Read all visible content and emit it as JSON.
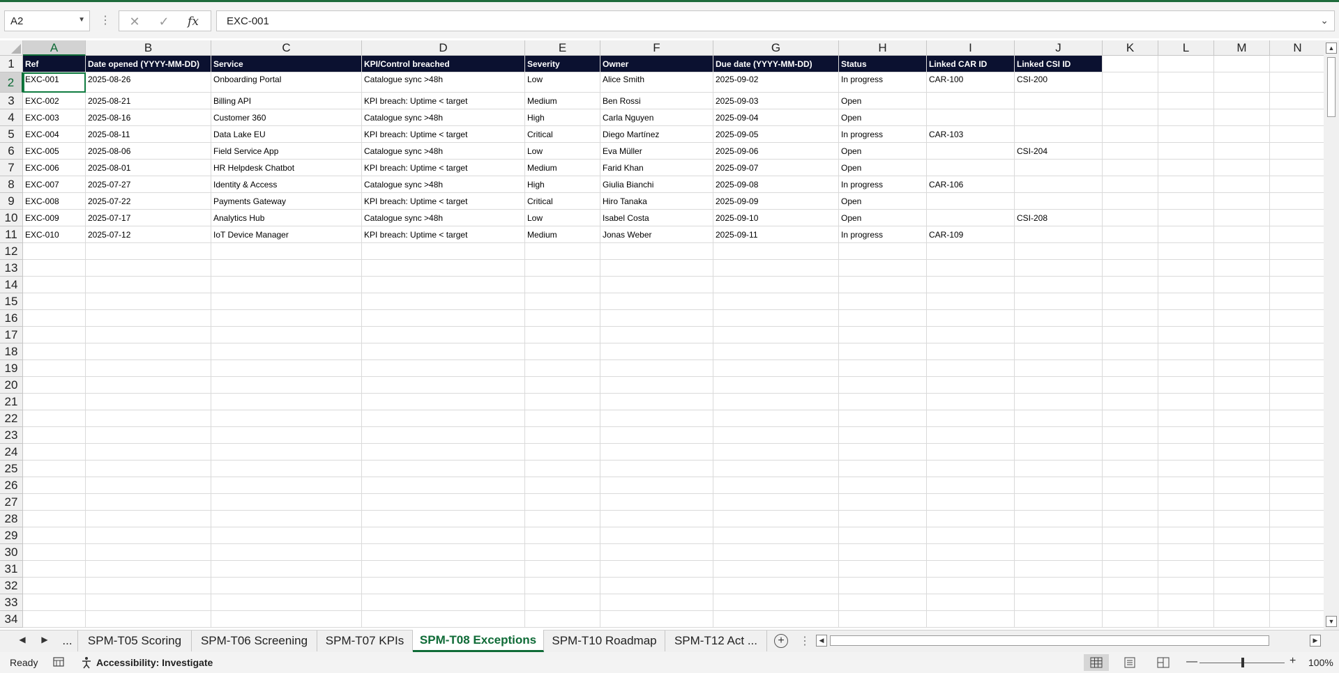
{
  "namebox": {
    "value": "A2"
  },
  "formula": {
    "value": "EXC-001"
  },
  "columns": [
    "A",
    "B",
    "C",
    "D",
    "E",
    "F",
    "G",
    "H",
    "I",
    "J",
    "K",
    "L",
    "M",
    "N"
  ],
  "rows": [
    "1",
    "2",
    "3",
    "4",
    "5",
    "6",
    "7",
    "8",
    "9",
    "10",
    "11",
    "12",
    "13",
    "14",
    "15",
    "16",
    "17",
    "18",
    "19",
    "20",
    "21",
    "22",
    "23",
    "24",
    "25",
    "26",
    "27",
    "28",
    "29",
    "30",
    "31",
    "32",
    "33",
    "34"
  ],
  "table": {
    "headers": [
      "Ref",
      "Date opened (YYYY-MM-DD)",
      "Service",
      "KPI/Control breached",
      "Severity",
      "Owner",
      "Due date (YYYY-MM-DD)",
      "Status",
      "Linked CAR ID",
      "Linked CSI ID"
    ],
    "rows": [
      [
        "EXC-001",
        "2025-08-26",
        "Onboarding Portal",
        "Catalogue sync >48h",
        "Low",
        "Alice Smith",
        "2025-09-02",
        "In progress",
        "CAR-100",
        "CSI-200"
      ],
      [
        "EXC-002",
        "2025-08-21",
        "Billing API",
        "KPI breach: Uptime < target",
        "Medium",
        "Ben Rossi",
        "2025-09-03",
        "Open",
        "",
        ""
      ],
      [
        "EXC-003",
        "2025-08-16",
        "Customer 360",
        "Catalogue sync >48h",
        "High",
        "Carla Nguyen",
        "2025-09-04",
        "Open",
        "",
        ""
      ],
      [
        "EXC-004",
        "2025-08-11",
        "Data Lake EU",
        "KPI breach: Uptime < target",
        "Critical",
        "Diego Martínez",
        "2025-09-05",
        "In progress",
        "CAR-103",
        ""
      ],
      [
        "EXC-005",
        "2025-08-06",
        "Field Service App",
        "Catalogue sync >48h",
        "Low",
        "Eva Müller",
        "2025-09-06",
        "Open",
        "",
        "CSI-204"
      ],
      [
        "EXC-006",
        "2025-08-01",
        "HR Helpdesk Chatbot",
        "KPI breach: Uptime < target",
        "Medium",
        "Farid Khan",
        "2025-09-07",
        "Open",
        "",
        ""
      ],
      [
        "EXC-007",
        "2025-07-27",
        "Identity & Access",
        "Catalogue sync >48h",
        "High",
        "Giulia Bianchi",
        "2025-09-08",
        "In progress",
        "CAR-106",
        ""
      ],
      [
        "EXC-008",
        "2025-07-22",
        "Payments Gateway",
        "KPI breach: Uptime < target",
        "Critical",
        "Hiro Tanaka",
        "2025-09-09",
        "Open",
        "",
        ""
      ],
      [
        "EXC-009",
        "2025-07-17",
        "Analytics Hub",
        "Catalogue sync >48h",
        "Low",
        "Isabel Costa",
        "2025-09-10",
        "Open",
        "",
        "CSI-208"
      ],
      [
        "EXC-010",
        "2025-07-12",
        "IoT Device Manager",
        "KPI breach: Uptime < target",
        "Medium",
        "Jonas Weber",
        "2025-09-11",
        "In progress",
        "CAR-109",
        ""
      ]
    ]
  },
  "tabs": {
    "more": "...",
    "items": [
      "SPM-T05 Scoring",
      "SPM-T06 Screening",
      "SPM-T07 KPIs",
      "SPM-T08 Exceptions",
      "SPM-T10 Roadmap",
      "SPM-T12 Act ..."
    ],
    "active_index": 3
  },
  "status": {
    "ready": "Ready",
    "accessibility": "Accessibility: Investigate",
    "zoom": "100%"
  },
  "colors": {
    "header_fill": "#0b1130",
    "accent": "#107c41"
  }
}
